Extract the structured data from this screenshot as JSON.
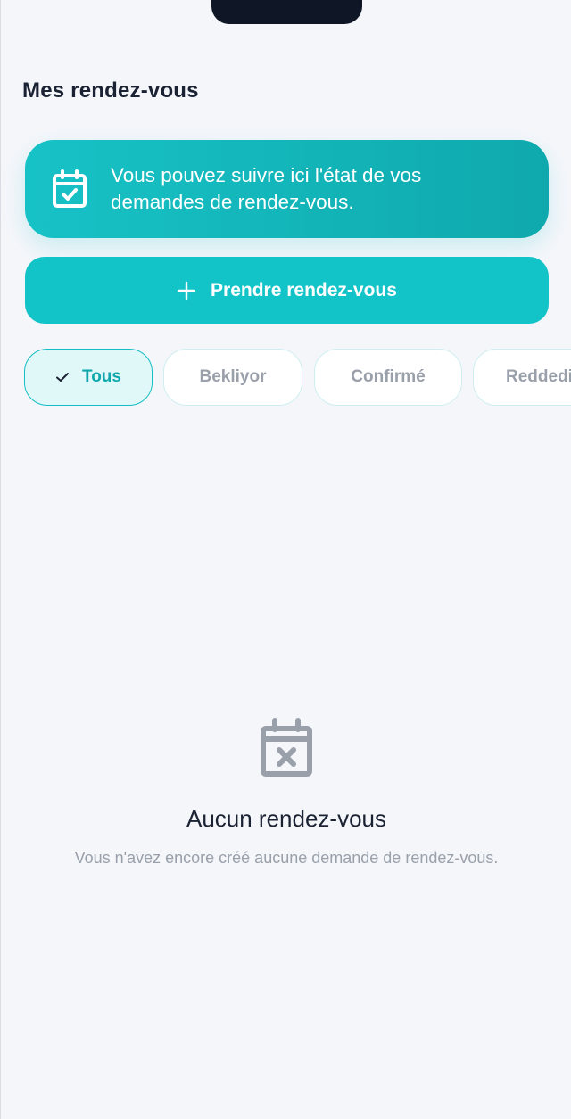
{
  "header": {
    "title": "Mes rendez-vous"
  },
  "info_card": {
    "icon": "calendar-check-icon",
    "text": "Vous pouvez suivre ici l'état de vos demandes de rendez-vous."
  },
  "book_button": {
    "icon": "plus-icon",
    "label": "Prendre rendez-vous"
  },
  "filters": [
    {
      "label": "Tous",
      "selected": true
    },
    {
      "label": "Bekliyor",
      "selected": false
    },
    {
      "label": "Confirmé",
      "selected": false
    },
    {
      "label": "Reddedildi",
      "selected": false
    }
  ],
  "empty_state": {
    "icon": "calendar-x-icon",
    "title": "Aucun rendez-vous",
    "subtitle": "Vous n'avez encore créé aucune demande de rendez-vous."
  },
  "colors": {
    "accent": "#12c3c8",
    "background": "#f4f6fa",
    "text_dark": "#1b2233",
    "text_muted": "#9aa0aa"
  }
}
